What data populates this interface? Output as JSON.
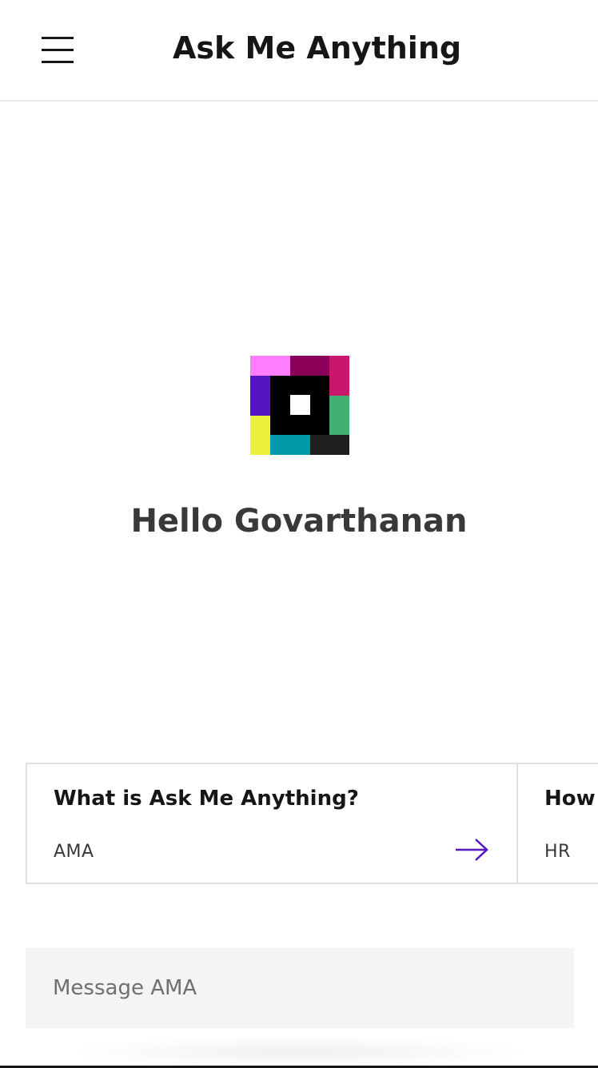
{
  "header": {
    "title": "Ask Me Anything",
    "menu_icon": "hamburger-menu-icon"
  },
  "logo": {
    "icon": "ama-logo-icon",
    "colors": {
      "pink": "#ff7eff",
      "plum": "#8a0058",
      "magenta": "#c9186b",
      "purple": "#5516c2",
      "green": "#42b072",
      "yellow": "#ecf03a",
      "teal": "#009aa8",
      "dark": "#1f1f1f",
      "black": "#000000",
      "white": "#ffffff"
    }
  },
  "greeting": "Hello Govarthanan",
  "suggestions": [
    {
      "title": "What is Ask Me Anything?",
      "tag": "AMA",
      "icon": "arrow-right-icon"
    },
    {
      "title": "How c",
      "tag": "HR"
    }
  ],
  "message": {
    "placeholder": "Message AMA",
    "value": ""
  },
  "colors": {
    "accent": "#5516c2",
    "input_background": "#f4f4f4",
    "border": "#e0e0e0"
  }
}
